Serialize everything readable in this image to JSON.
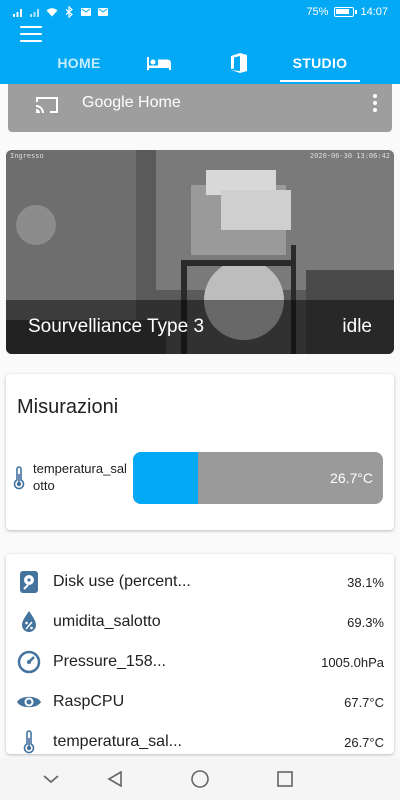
{
  "status_bar": {
    "battery": "75%",
    "time": "14:07"
  },
  "tabs": [
    {
      "label": "HOME",
      "icon": ""
    },
    {
      "label": "",
      "icon": "bed-icon"
    },
    {
      "label": "",
      "icon": "office-icon"
    },
    {
      "label": "STUDIO",
      "icon": ""
    }
  ],
  "google_home": {
    "title": "Google Home"
  },
  "camera": {
    "overlay_left": "Ingresso",
    "overlay_right": "2020-06-30 13:06:42",
    "name": "Sourvelliance Type 3",
    "state": "idle"
  },
  "measurements": {
    "title": "Misurazioni",
    "sensor_label": "temperatura_salotto",
    "value": "26.7°C",
    "fill_percent": 26
  },
  "sensors": [
    {
      "name": "Disk use (percent...",
      "value": "38.1%",
      "icon": "harddisk-icon"
    },
    {
      "name": "umidita_salotto",
      "value": "69.3%",
      "icon": "humidity-icon"
    },
    {
      "name": "Pressure_158...",
      "value": "1005.0hPa",
      "icon": "gauge-icon"
    },
    {
      "name": "RaspCPU",
      "value": "67.7°C",
      "icon": "eye-icon"
    },
    {
      "name": "temperatura_sal...",
      "value": "26.7°C",
      "icon": "thermometer-icon"
    }
  ],
  "colors": {
    "accent": "#03a9f4",
    "icon_blue": "#44739e",
    "bar_bg": "#9a9a9a"
  }
}
